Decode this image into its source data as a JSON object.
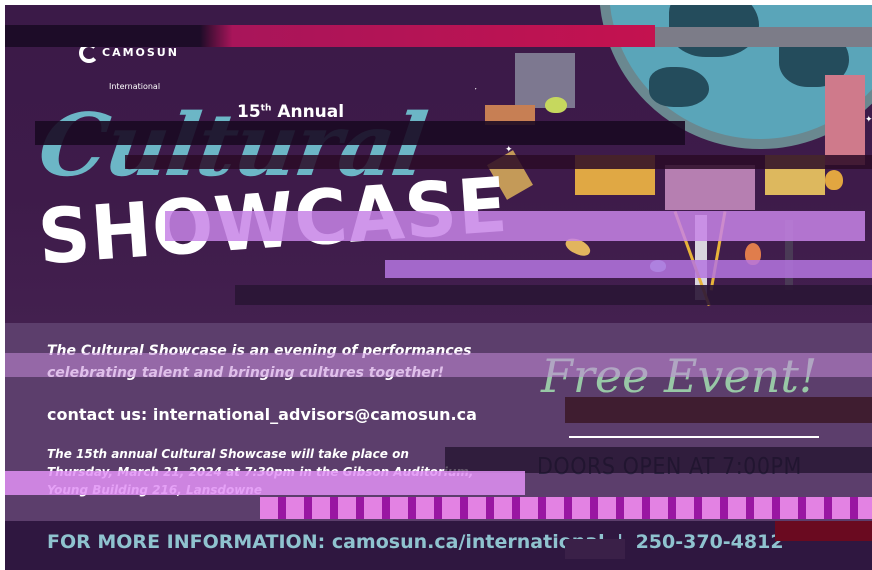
{
  "logo": {
    "name": "CAMOSUN",
    "subtitle": "International"
  },
  "event": {
    "edition": "15",
    "edition_suffix": "th",
    "annual_word": "Annual",
    "title_script": "Cultural",
    "title_block": "SHOWCASE"
  },
  "description": {
    "line1": "The Cultural Showcase is an evening of performances",
    "line2": "celebrating talent and bringing cultures together!"
  },
  "contact": {
    "label": "contact us:",
    "email": "international_advisors@camosun.ca"
  },
  "details": {
    "line1": "The 15th annual Cultural Showcase will take place on",
    "line2": "Thursday, March 21, 2024 at 7:30pm in the Gibson Auditorium,",
    "line3": "Young Building 216, Lansdowne"
  },
  "free_event": "Free Event!",
  "doors_open": "DOORS OPEN AT 7:00PM",
  "footer": {
    "label": "FOR MORE INFORMATION:",
    "website": "camosun.ca/international",
    "separator": "|",
    "phone": "250-370-4812"
  },
  "colors": {
    "background": "#3d1a4a",
    "title_script": "#6cb6c6",
    "free_event": "#98c8a6",
    "footer_text": "#8fc3cf"
  }
}
